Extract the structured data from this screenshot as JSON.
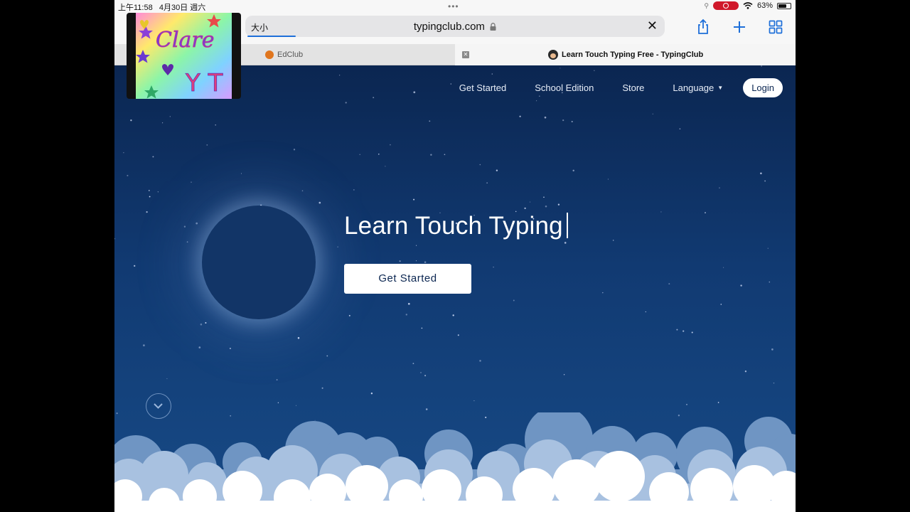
{
  "status_bar": {
    "time": "上午11:58",
    "date": "4月30日 週六",
    "battery": "63%"
  },
  "toolbar": {
    "text_size_label": "大小",
    "url": "typingclub.com"
  },
  "tabs": [
    {
      "label": "EdClub",
      "active": false
    },
    {
      "label": "Learn Touch Typing Free - TypingClub",
      "active": true
    }
  ],
  "nav": {
    "items": [
      "Get Started",
      "School Edition",
      "Store",
      "Language"
    ],
    "login": "Login"
  },
  "hero": {
    "title": "Learn Touch Typing",
    "cta": "Get Started"
  },
  "thumbnail": {
    "text_top": "Clare",
    "text_bottom": "Y T"
  },
  "colors": {
    "page_top": "#0b2651",
    "page_bottom": "#174a86",
    "accent": "#1e6fd9",
    "recording": "#d0182a"
  }
}
